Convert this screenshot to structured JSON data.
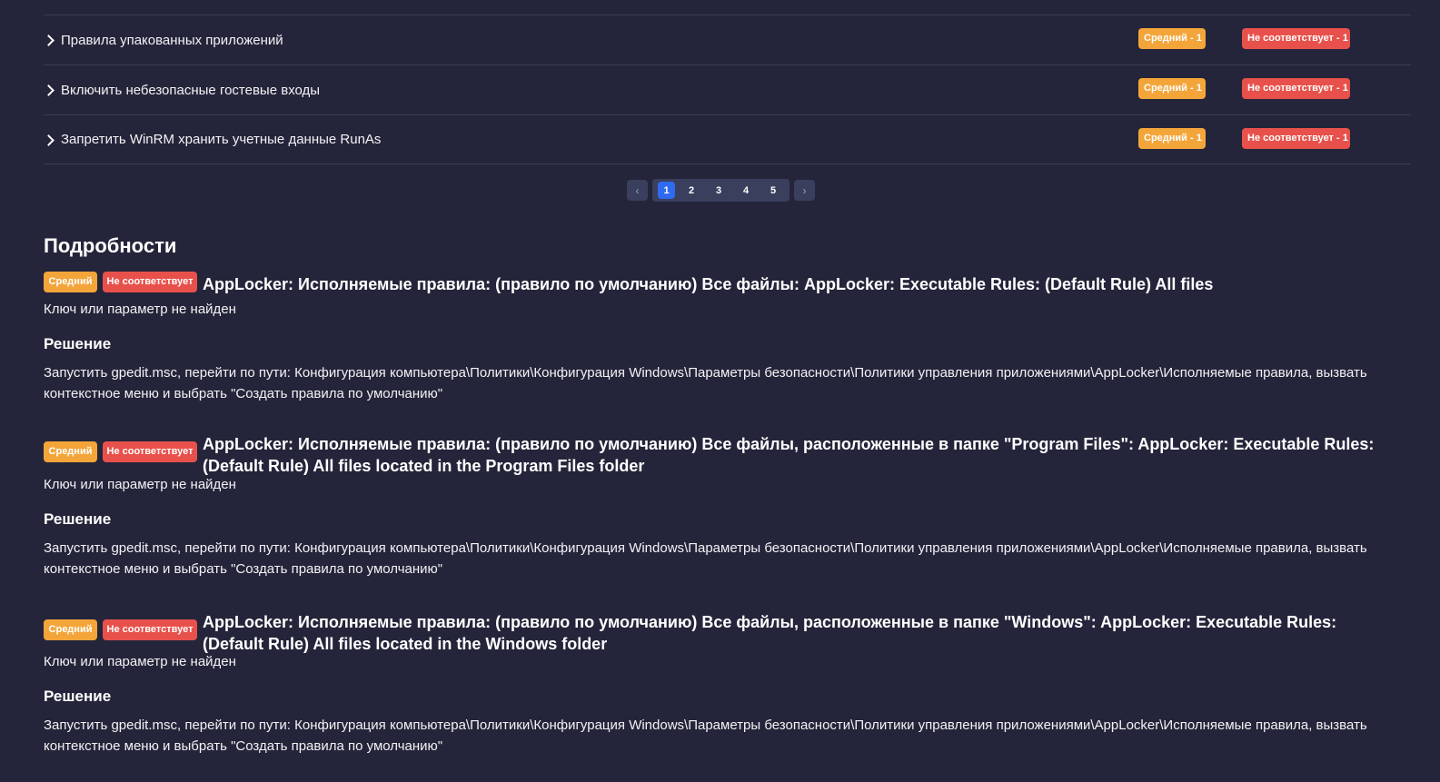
{
  "rows": [
    {
      "label": "Правила упакованных приложений",
      "severity": "Средний - 1",
      "status": "Не соответствует - 1"
    },
    {
      "label": "Включить небезопасные гостевые входы",
      "severity": "Средний - 1",
      "status": "Не соответствует - 1"
    },
    {
      "label": "Запретить WinRM хранить учетные данные RunAs",
      "severity": "Средний - 1",
      "status": "Не соответствует - 1"
    }
  ],
  "pagination": {
    "prev_icon": "chevron-left-icon",
    "next_icon": "chevron-right-icon",
    "pages": [
      "1",
      "2",
      "3",
      "4",
      "5"
    ],
    "active_page": "1"
  },
  "details": {
    "title": "Подробности",
    "items": [
      {
        "severity": "Средний",
        "status": "Не соответствует",
        "title": "AppLocker: Исполняемые правила: (правило по умолчанию) Все файлы: AppLocker: Executable Rules: (Default Rule) All files",
        "message": "Ключ или параметр не найден",
        "solution_heading": "Решение",
        "solution": "Запустить gpedit.msc, перейти по пути: Конфигурация компьютера\\Политики\\Конфигурация Windows\\Параметры безопасности\\Политики управления приложениями\\AppLocker\\Исполняемые правила, вызвать контекстное меню и выбрать \"Создать правила по умолчанию\""
      },
      {
        "severity": "Средний",
        "status": "Не соответствует",
        "title": "AppLocker: Исполняемые правила: (правило по умолчанию) Все файлы, расположенные в папке \"Program Files\": AppLocker: Executable Rules: (Default Rule) All files located in the Program Files folder",
        "message": "Ключ или параметр не найден",
        "solution_heading": "Решение",
        "solution": "Запустить gpedit.msc, перейти по пути: Конфигурация компьютера\\Политики\\Конфигурация Windows\\Параметры безопасности\\Политики управления приложениями\\AppLocker\\Исполняемые правила, вызвать контекстное меню и выбрать \"Создать правила по умолчанию\""
      },
      {
        "severity": "Средний",
        "status": "Не соответствует",
        "title": "AppLocker: Исполняемые правила: (правило по умолчанию) Все файлы, расположенные в папке \"Windows\": AppLocker: Executable Rules: (Default Rule) All files located in the Windows folder",
        "message": "Ключ или параметр не найден",
        "solution_heading": "Решение",
        "solution": "Запустить gpedit.msc, перейти по пути: Конфигурация компьютера\\Политики\\Конфигурация Windows\\Параметры безопасности\\Политики управления приложениями\\AppLocker\\Исполняемые правила, вызвать контекстное меню и выбрать \"Создать правила по умолчанию\""
      }
    ]
  },
  "colors": {
    "background": "#24253a",
    "severity_badge": "#f4a53a",
    "status_badge": "#e8514b",
    "active_page": "#2f6bf0"
  }
}
